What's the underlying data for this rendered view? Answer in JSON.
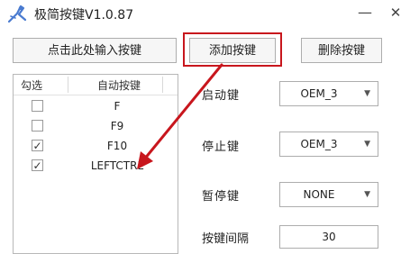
{
  "window": {
    "title": "极简按键V1.0.87",
    "minimize_icon": "minimize-icon",
    "close_icon": "close-icon"
  },
  "toolbar": {
    "input_label": "点击此处输入按键",
    "add_label": "添加按键",
    "delete_label": "删除按键"
  },
  "key_list": {
    "headers": {
      "check": "勾选",
      "key": "自动按键"
    },
    "rows": [
      {
        "key": "F",
        "checked": false
      },
      {
        "key": "F9",
        "checked": false
      },
      {
        "key": "F10",
        "checked": true
      },
      {
        "key": "LEFTCTRL",
        "checked": true
      }
    ]
  },
  "settings": {
    "start_label": "启动键",
    "start_value": "OEM_3",
    "stop_label": "停止键",
    "stop_value": "OEM_3",
    "pause_label": "暂停键",
    "pause_value": "NONE",
    "interval_label": "按键间隔",
    "interval_value": "30"
  },
  "colors": {
    "highlight": "#c8161d",
    "annotation_arrow": "#c8161d",
    "app_icon": "#4a7bd0"
  }
}
